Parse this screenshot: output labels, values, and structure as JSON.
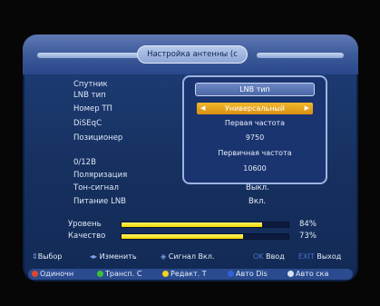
{
  "title": "Настройка антенны (с",
  "fields": [
    {
      "label": "Спутник"
    },
    {
      "label": "LNB тип"
    },
    {
      "label": "Номер ТП"
    },
    {
      "label": "DiSEqC"
    },
    {
      "label": "Позиционер"
    },
    {
      "label": "0/12В"
    },
    {
      "label": "Поляризация"
    },
    {
      "label": "Тон-сигнал",
      "value": "Выкл."
    },
    {
      "label": "Питание LNB",
      "value": "Вкл."
    }
  ],
  "popup": {
    "title": "LNB тип",
    "selected": "Универсальный",
    "items": [
      "Первая частота",
      "9750",
      "Первичная частота",
      "10600"
    ]
  },
  "signal": {
    "level_label": "Уровень",
    "level_value": "84%",
    "level_fraction": 0.84,
    "quality_label": "Качество",
    "quality_value": "73%",
    "quality_fraction": 0.73
  },
  "hints": {
    "select": "Выбор",
    "change": "Изменить",
    "signal": "Сигнал Вкл.",
    "ok_key": "OK",
    "ok_label": "Ввод",
    "exit_key": "EXIT",
    "exit_label": "Выход"
  },
  "footer": {
    "red": "Одиночн",
    "green": "Трансп. С",
    "yellow": "Редакт. Т",
    "blue": "Авто Dis",
    "white": "Авто ска"
  },
  "colors": {
    "accent": "#f0b429",
    "bar": "#f3e31a",
    "panel": "#16305f",
    "red": "#e0452c",
    "green": "#3bbf3b",
    "yellow": "#f2d21e",
    "blue": "#2f63d8",
    "white": "#d7e1f2"
  }
}
